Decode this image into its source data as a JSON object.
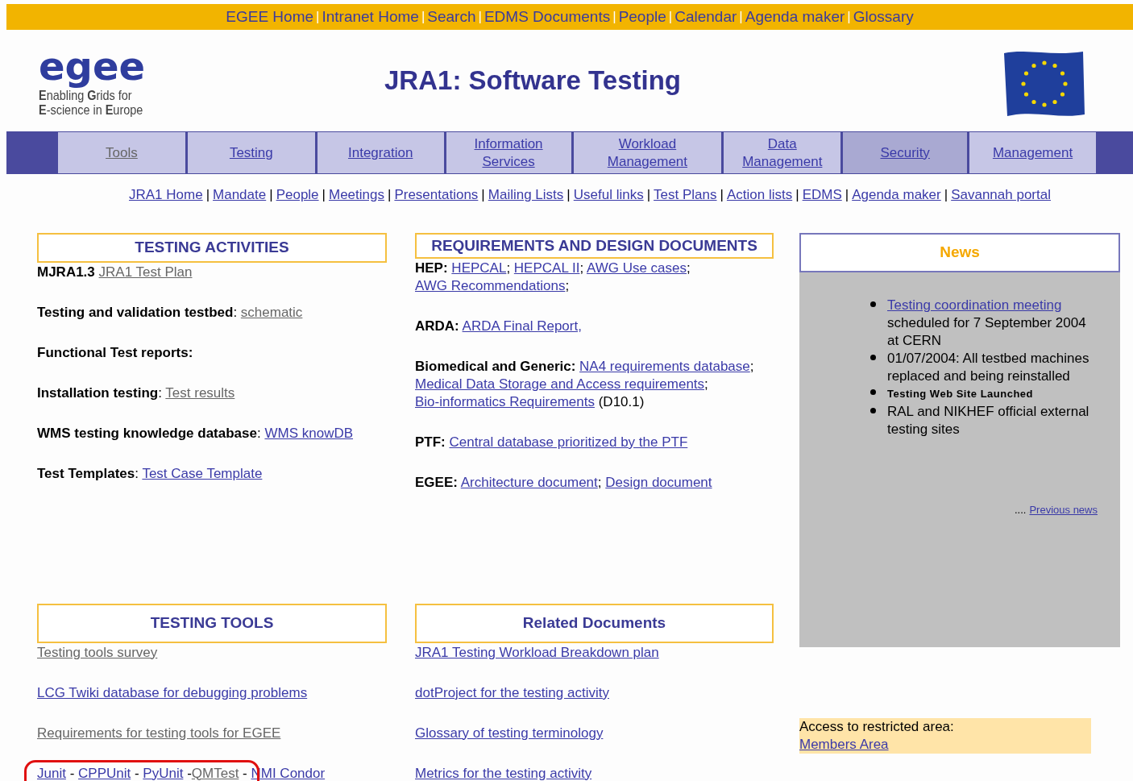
{
  "top_links": {
    "separator": "|",
    "items": [
      {
        "label": "EGEE Home"
      },
      {
        "label": "Intranet Home"
      },
      {
        "label": "Search"
      },
      {
        "label": "EDMS Documents"
      },
      {
        "label": "People"
      },
      {
        "label": "Calendar"
      },
      {
        "label": "Agenda maker"
      },
      {
        "label": "Glossary"
      }
    ]
  },
  "logo": {
    "wordmark": "egee",
    "tagline": [
      "**E**nabling **G**rids for",
      "**E**-science in **E**urope"
    ]
  },
  "title": "JRA1: Software Testing",
  "nav_tabs": [
    {
      "label": "Tools",
      "visited": true,
      "selected": false
    },
    {
      "label": "Testing",
      "visited": false,
      "selected": false
    },
    {
      "label": "Integration",
      "visited": false,
      "selected": false
    },
    {
      "label": "Information Services",
      "visited": false,
      "selected": false
    },
    {
      "label": "Workload Management",
      "visited": false,
      "selected": false
    },
    {
      "label": "Data Management",
      "visited": false,
      "selected": false
    },
    {
      "label": "Security",
      "visited": false,
      "selected": true
    },
    {
      "label": "Management",
      "visited": false,
      "selected": false
    }
  ],
  "sub_links": {
    "separator": "|",
    "items": [
      {
        "label": "JRA1 Home"
      },
      {
        "label": "Mandate"
      },
      {
        "label": "People"
      },
      {
        "label": "Meetings"
      },
      {
        "label": "Presentations"
      },
      {
        "label": "Mailing Lists"
      },
      {
        "label": "Useful links"
      },
      {
        "label": "Test Plans"
      },
      {
        "label": "Action lists"
      },
      {
        "label": "EDMS"
      },
      {
        "label": "Agenda maker"
      },
      {
        "label": "Savannah portal"
      }
    ]
  },
  "testing_activities": {
    "heading": "TESTING ACTIVITIES",
    "paragraphs": [
      [
        {
          "kind": "label",
          "text": "MJRA1.3"
        },
        {
          "kind": "link",
          "text": "JRA1 Test Plan",
          "visited": true
        }
      ],
      [
        {
          "kind": "label",
          "text": "Testing and validation testbed"
        },
        {
          "kind": "text",
          "text": ": "
        },
        {
          "kind": "link",
          "text": "schematic",
          "visited": true
        }
      ],
      [
        {
          "kind": "label",
          "text": "Functional Test reports:"
        }
      ],
      [
        {
          "kind": "label",
          "text": "Installation testing"
        },
        {
          "kind": "text",
          "text": ": "
        },
        {
          "kind": "link",
          "text": "Test results",
          "visited": true
        }
      ],
      [
        {
          "kind": "label",
          "text": "WMS testing knowledge database"
        },
        {
          "kind": "text",
          "text": ": "
        },
        {
          "kind": "link",
          "text": "WMS knowDB",
          "visited": false
        }
      ],
      [
        {
          "kind": "label",
          "text": "Test Templates"
        },
        {
          "kind": "text",
          "text": ": "
        },
        {
          "kind": "link",
          "text": "Test Case Template",
          "visited": false
        }
      ]
    ]
  },
  "requirements": {
    "heading": "REQUIREMENTS AND DESIGN DOCUMENTS",
    "paragraphs": [
      [
        {
          "kind": "label",
          "text": "HEP:"
        },
        {
          "kind": "link",
          "text": "HEPCAL",
          "visited": false
        },
        {
          "kind": "text",
          "text": "; "
        },
        {
          "kind": "link",
          "text": "HEPCAL II",
          "visited": false
        },
        {
          "kind": "text",
          "text": "; "
        },
        {
          "kind": "link",
          "text": "AWG Use cases",
          "visited": false
        },
        {
          "kind": "text",
          "text": "; "
        },
        {
          "kind": "link",
          "text": "AWG Recommendations",
          "visited": false
        },
        {
          "kind": "text",
          "text": ";"
        }
      ],
      [
        {
          "kind": "label",
          "text": "ARDA:"
        },
        {
          "kind": "link",
          "text": "ARDA Final Report,",
          "visited": false
        }
      ],
      [
        {
          "kind": "label",
          "text": "Biomedical and Generic:"
        },
        {
          "kind": "link",
          "text": "NA4 requirements database",
          "visited": false
        },
        {
          "kind": "text",
          "text": "; "
        },
        {
          "kind": "link",
          "text": "Medical Data Storage and Access requirements",
          "visited": false
        },
        {
          "kind": "text",
          "text": "; "
        },
        {
          "kind": "link",
          "text": "Bio-informatics Requirements",
          "visited": false
        },
        {
          "kind": "text",
          "text": " (D10.1)"
        }
      ],
      [
        {
          "kind": "label",
          "text": "PTF:"
        },
        {
          "kind": "link",
          "text": "Central database prioritized by the PTF",
          "visited": false
        }
      ],
      [
        {
          "kind": "label",
          "text": "EGEE:"
        },
        {
          "kind": "link",
          "text": "Architecture document",
          "visited": false
        },
        {
          "kind": "text",
          "text": "; "
        },
        {
          "kind": "link",
          "text": "Design document",
          "visited": false
        }
      ]
    ]
  },
  "news": {
    "heading": "News",
    "items": [
      {
        "kind": "item",
        "parts": [
          {
            "kind": "link",
            "text": "Testing coordination meeting",
            "visited": false
          },
          {
            "kind": "text",
            "text": " scheduled for 7 September 2004 at CERN"
          }
        ]
      },
      {
        "kind": "item",
        "parts": [
          {
            "kind": "text",
            "text": "01/07/2004: All testbed machines replaced and being reinstalled"
          }
        ]
      },
      {
        "kind": "announcement",
        "parts": [
          {
            "kind": "text",
            "text": "Testing Web Site Launched"
          }
        ]
      },
      {
        "kind": "item",
        "parts": [
          {
            "kind": "text",
            "text": "RAL and NIKHEF official external testing sites"
          }
        ]
      }
    ],
    "more": {
      "prefix": "....",
      "link": "Previous news"
    }
  },
  "testing_tools": {
    "heading": "TESTING TOOLS",
    "paragraphs": [
      {
        "circled": false,
        "parts": [
          {
            "kind": "link",
            "text": "Testing tools survey",
            "visited": true
          }
        ]
      },
      {
        "circled": false,
        "parts": [
          {
            "kind": "link",
            "text": "LCG Twiki database for debugging problems",
            "visited": false
          }
        ]
      },
      {
        "circled": false,
        "parts": [
          {
            "kind": "link",
            "text": "Requirements for testing tools for EGEE",
            "visited": true
          }
        ]
      },
      {
        "circled": true,
        "parts": [
          {
            "kind": "link",
            "text": "Junit",
            "visited": false
          },
          {
            "kind": "text",
            "text": " - "
          },
          {
            "kind": "link",
            "text": "CPPUnit",
            "visited": false
          },
          {
            "kind": "text",
            "text": " - "
          },
          {
            "kind": "link",
            "text": "PyUnit",
            "visited": false
          },
          {
            "kind": "text",
            "text": " -"
          },
          {
            "kind": "link",
            "text": "QMTest",
            "visited": true
          },
          {
            "kind": "text",
            "text": " - "
          },
          {
            "kind": "link",
            "text": "NMI Condor",
            "visited": false
          }
        ]
      }
    ]
  },
  "related_documents": {
    "heading": "Related Documents",
    "paragraphs": [
      {
        "circled": false,
        "parts": [
          {
            "kind": "link",
            "text": "JRA1 Testing Workload Breakdown plan",
            "visited": false
          }
        ]
      },
      {
        "circled": false,
        "parts": [
          {
            "kind": "link",
            "text": "dotProject for the testing activity",
            "visited": false
          }
        ]
      },
      {
        "circled": false,
        "parts": [
          {
            "kind": "link",
            "text": "Glossary of testing terminology",
            "visited": false
          }
        ]
      },
      {
        "circled": false,
        "parts": [
          {
            "kind": "link",
            "text": "Metrics for the testing activity",
            "visited": false
          }
        ]
      }
    ]
  },
  "restricted_area": {
    "text": "Access to restricted area:",
    "link": "Members Area"
  }
}
